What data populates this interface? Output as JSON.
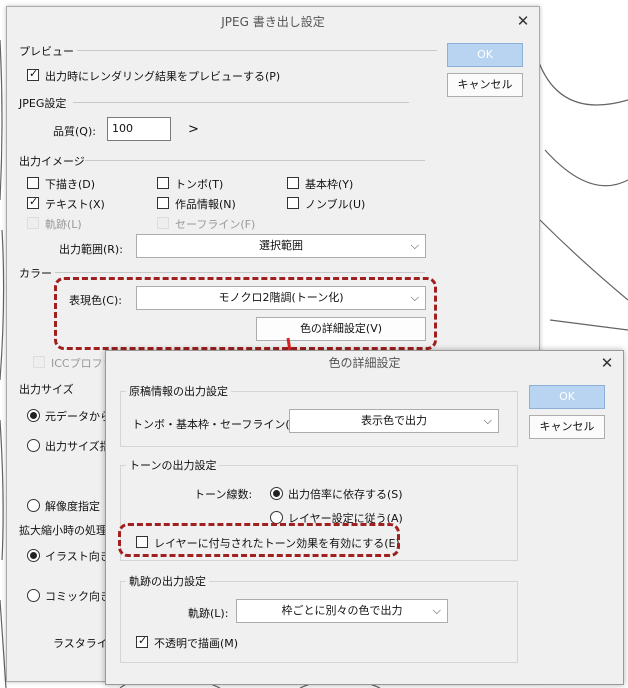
{
  "dialog_main": {
    "title": "JPEG 書き出し設定",
    "ok": "OK",
    "cancel": "キャンセル",
    "preview": {
      "section": "プレビュー",
      "render_preview": "出力時にレンダリング結果をプレビューする(P)",
      "render_preview_checked": true
    },
    "jpeg": {
      "section": "JPEG設定",
      "quality_label": "品質(Q):",
      "quality_value": "100",
      "quality_arrow": ">"
    },
    "output_image": {
      "section": "出力イメージ",
      "items": [
        {
          "label": "下描き(D)",
          "checked": false,
          "disabled": false
        },
        {
          "label": "トンボ(T)",
          "checked": false,
          "disabled": false
        },
        {
          "label": "基本枠(Y)",
          "checked": false,
          "disabled": false
        },
        {
          "label": "テキスト(X)",
          "checked": true,
          "disabled": false
        },
        {
          "label": "作品情報(N)",
          "checked": false,
          "disabled": false
        },
        {
          "label": "ノンブル(U)",
          "checked": false,
          "disabled": false
        },
        {
          "label": "軌跡(L)",
          "checked": false,
          "disabled": true
        },
        {
          "label": "セーフライン(F)",
          "checked": false,
          "disabled": true
        }
      ],
      "range_label": "出力範囲(R):",
      "range_value": "選択範囲"
    },
    "color": {
      "section": "カラー",
      "expression_label": "表現色(C):",
      "expression_value": "モノクロ2階調(トーン化)",
      "detail_button": "色の詳細設定(V)",
      "icc_label": "ICCプロファ"
    },
    "output_size": {
      "section": "出力サイズ",
      "opt1": "元データから(",
      "opt2": "出力サイズ指",
      "opt3": "解像度指定"
    },
    "scaling": {
      "section": "拡大縮小時の処理",
      "opt1": "イラスト向き(",
      "opt2": "コミック向き(C",
      "rasterize": "ラスタライズ"
    }
  },
  "dialog_detail": {
    "title": "色の詳細設定",
    "ok": "OK",
    "cancel": "キャンセル",
    "manuscript": {
      "section": "原稿情報の出力設定",
      "label": "トンボ・基本枠・セーフライン(T):",
      "value": "表示色で出力"
    },
    "tone": {
      "section": "トーンの出力設定",
      "lines_label": "トーン線数:",
      "opt1": "出力倍率に依存する(S)",
      "opt1_selected": true,
      "opt2": "レイヤー設定に従う(A)",
      "layer_effect": "レイヤーに付与されたトーン効果を有効にする(E)",
      "layer_effect_checked": false
    },
    "trail": {
      "section": "軌跡の出力設定",
      "label": "軌跡(L):",
      "value": "枠ごとに別々の色で出力",
      "opaque": "不透明で描画(M)",
      "opaque_checked": true
    }
  },
  "colors": {
    "highlight": "#a02020",
    "arrow": "#e02020",
    "ok_button": "#b8d4f0"
  }
}
